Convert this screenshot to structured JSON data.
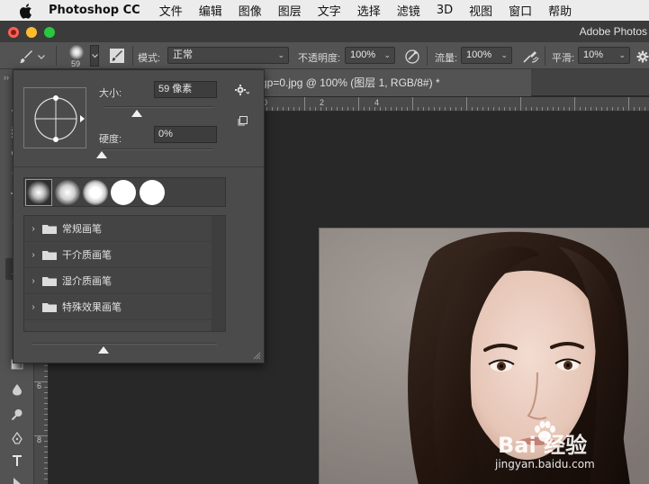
{
  "menubar": {
    "app_name": "Photoshop CC",
    "items": [
      "文件",
      "编辑",
      "图像",
      "图层",
      "文字",
      "选择",
      "滤镜",
      "3D",
      "视图",
      "窗口",
      "帮助"
    ]
  },
  "window": {
    "title": "Adobe Photos"
  },
  "options_bar": {
    "brush_size_value": "59",
    "mode_label": "模式:",
    "mode_value": "正常",
    "opacity_label": "不透明度:",
    "opacity_value": "100%",
    "flow_label": "流量:",
    "flow_value": "100%",
    "smoothing_label": "平滑:",
    "smoothing_value": "10%"
  },
  "document": {
    "tab_title": "gp=0.jpg @ 100% (图层 1, RGB/8#) *"
  },
  "rulers": {
    "top_numbers": [
      "0",
      "2",
      "4"
    ],
    "left_numbers": [
      "6",
      "8"
    ]
  },
  "brush_panel": {
    "size_label": "大小:",
    "size_value": "59 像素",
    "size_fraction": 0.3,
    "hardness_label": "硬度:",
    "hardness_value": "0%",
    "hardness_fraction": 0.0,
    "folders": [
      {
        "label": "常规画笔"
      },
      {
        "label": "干介质画笔"
      },
      {
        "label": "湿介质画笔"
      },
      {
        "label": "特殊效果画笔"
      }
    ]
  },
  "watermark": {
    "brand": "Bai 经验",
    "url": "jingyan.baidu.com"
  },
  "colors": {
    "chrome": "#535353",
    "panel": "#4b4b4b",
    "canvas": "#282828",
    "menubar": "#ececec"
  }
}
